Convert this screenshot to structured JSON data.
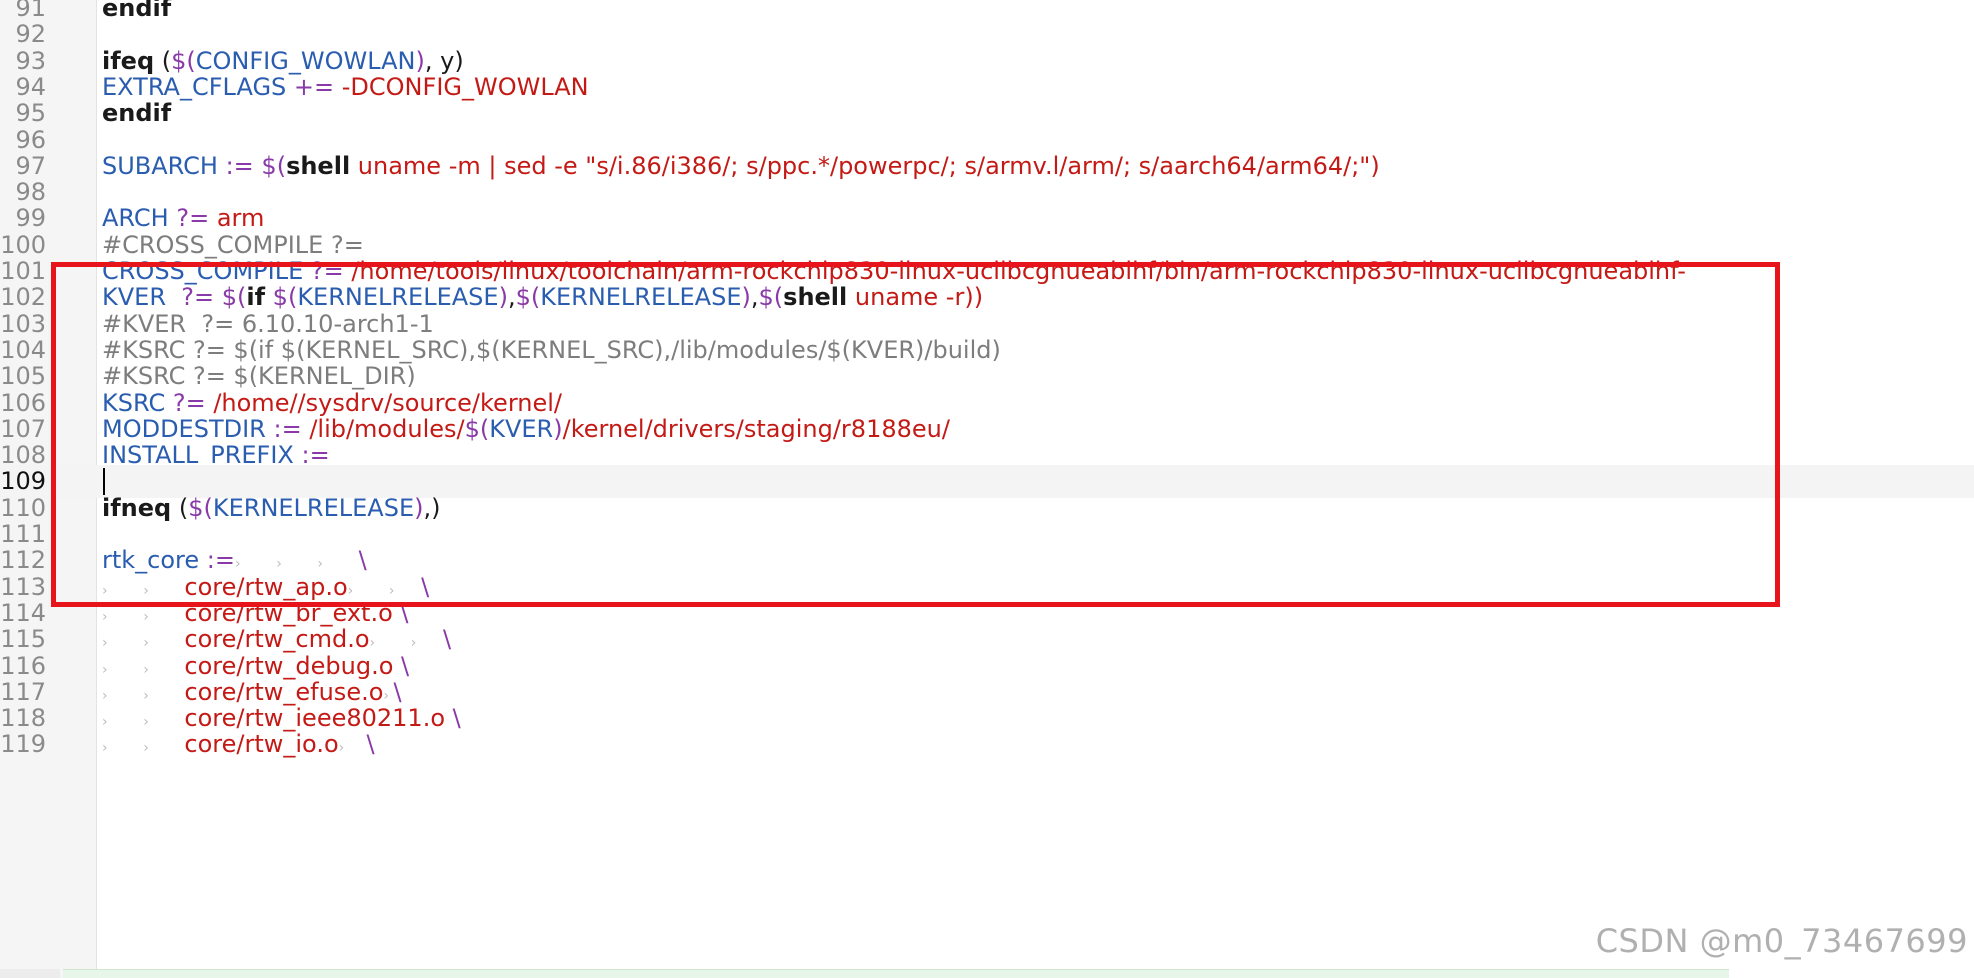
{
  "editor": {
    "current_line": "109",
    "lines": [
      {
        "n": "91",
        "tokens": [
          {
            "t": "kw",
            "x": "endif"
          }
        ]
      },
      {
        "n": "92",
        "tokens": []
      },
      {
        "n": "93",
        "tokens": [
          {
            "t": "kw",
            "x": "ifeq"
          },
          {
            "t": "p",
            "x": " ("
          },
          {
            "t": "op",
            "x": "$("
          },
          {
            "t": "v",
            "x": "CONFIG_WOWLAN"
          },
          {
            "t": "op",
            "x": ")"
          },
          {
            "t": "p",
            "x": ", y)"
          }
        ]
      },
      {
        "n": "94",
        "tokens": [
          {
            "t": "v",
            "x": "EXTRA_CFLAGS"
          },
          {
            "t": "op",
            "x": " += "
          },
          {
            "t": "s",
            "x": "-DCONFIG_WOWLAN"
          }
        ]
      },
      {
        "n": "95",
        "tokens": [
          {
            "t": "kw",
            "x": "endif"
          }
        ]
      },
      {
        "n": "96",
        "tokens": []
      },
      {
        "n": "97",
        "tokens": [
          {
            "t": "v",
            "x": "SUBARCH"
          },
          {
            "t": "op",
            "x": " := "
          },
          {
            "t": "op",
            "x": "$("
          },
          {
            "t": "kw",
            "x": "shell"
          },
          {
            "t": "s",
            "x": " uname -m | sed -e \"s/i.86/i386/; s/ppc.*/powerpc/; s/armv.l/arm/; s/aarch64/arm64/;\")"
          }
        ]
      },
      {
        "n": "98",
        "tokens": []
      },
      {
        "n": "99",
        "tokens": [
          {
            "t": "v",
            "x": "ARCH"
          },
          {
            "t": "op",
            "x": " ?= "
          },
          {
            "t": "s",
            "x": "arm"
          }
        ]
      },
      {
        "n": "100",
        "tokens": [
          {
            "t": "c",
            "x": "#CROSS_COMPILE ?="
          }
        ]
      },
      {
        "n": "101",
        "tokens": [
          {
            "t": "v",
            "x": "CROSS_COMPILE"
          },
          {
            "t": "op",
            "x": " ?= "
          },
          {
            "t": "s",
            "x": "/home/tools/linux/toolchain/arm-rockchip830-linux-uclibcgnueabihf/bin/arm-rockchip830-linux-uclibcgnueabihf-"
          }
        ]
      },
      {
        "n": "102",
        "tokens": [
          {
            "t": "v",
            "x": "KVER"
          },
          {
            "t": "op",
            "x": "  ?= "
          },
          {
            "t": "op",
            "x": "$("
          },
          {
            "t": "kw",
            "x": "if"
          },
          {
            "t": "op",
            "x": " $("
          },
          {
            "t": "v",
            "x": "KERNELRELEASE"
          },
          {
            "t": "op",
            "x": ")"
          },
          {
            "t": "p",
            "x": ","
          },
          {
            "t": "op",
            "x": "$("
          },
          {
            "t": "v",
            "x": "KERNELRELEASE"
          },
          {
            "t": "op",
            "x": ")"
          },
          {
            "t": "p",
            "x": ","
          },
          {
            "t": "op",
            "x": "$("
          },
          {
            "t": "kw",
            "x": "shell"
          },
          {
            "t": "s",
            "x": " uname -r))"
          }
        ]
      },
      {
        "n": "103",
        "tokens": [
          {
            "t": "c",
            "x": "#KVER  ?= 6.10.10-arch1-1"
          }
        ]
      },
      {
        "n": "104",
        "tokens": [
          {
            "t": "c",
            "x": "#KSRC ?= $(if $(KERNEL_SRC),$(KERNEL_SRC),/lib/modules/$(KVER)/build)"
          }
        ]
      },
      {
        "n": "105",
        "tokens": [
          {
            "t": "c",
            "x": "#KSRC ?= $(KERNEL_DIR)"
          }
        ]
      },
      {
        "n": "106",
        "tokens": [
          {
            "t": "v",
            "x": "KSRC"
          },
          {
            "t": "op",
            "x": " ?= "
          },
          {
            "t": "s",
            "x": "/home//sysdrv/source/kernel/"
          }
        ]
      },
      {
        "n": "107",
        "tokens": [
          {
            "t": "v",
            "x": "MODDESTDIR"
          },
          {
            "t": "op",
            "x": " := "
          },
          {
            "t": "s",
            "x": "/lib/modules/"
          },
          {
            "t": "op",
            "x": "$("
          },
          {
            "t": "v",
            "x": "KVER"
          },
          {
            "t": "op",
            "x": ")"
          },
          {
            "t": "s",
            "x": "/kernel/drivers/staging/r8188eu/"
          }
        ]
      },
      {
        "n": "108",
        "tokens": [
          {
            "t": "v",
            "x": "INSTALL_PREFIX"
          },
          {
            "t": "op",
            "x": " :="
          }
        ]
      },
      {
        "n": "109",
        "tokens": []
      },
      {
        "n": "110",
        "tokens": [
          {
            "t": "kw",
            "x": "ifneq"
          },
          {
            "t": "p",
            "x": " ("
          },
          {
            "t": "op",
            "x": "$("
          },
          {
            "t": "v",
            "x": "KERNELRELEASE"
          },
          {
            "t": "op",
            "x": ")"
          },
          {
            "t": "p",
            "x": ",)"
          }
        ]
      },
      {
        "n": "111",
        "tokens": []
      },
      {
        "n": "112",
        "tokens": [
          {
            "t": "v",
            "x": "rtk_core"
          },
          {
            "t": "op",
            "x": " :="
          },
          {
            "t": "tab",
            "x": "›        ›        ›        "
          },
          {
            "t": "op",
            "x": "\\"
          }
        ]
      },
      {
        "n": "113",
        "tokens": [
          {
            "t": "tab",
            "x": "›        ›        "
          },
          {
            "t": "s",
            "x": "core/rtw_ap.o"
          },
          {
            "t": "tab",
            "x": "›        ›      "
          },
          {
            "t": "op",
            "x": "\\"
          }
        ]
      },
      {
        "n": "114",
        "tokens": [
          {
            "t": "tab",
            "x": "›        ›        "
          },
          {
            "t": "s",
            "x": "core/rtw_br_ext.o"
          },
          {
            "t": "op",
            "x": " \\"
          }
        ]
      },
      {
        "n": "115",
        "tokens": [
          {
            "t": "tab",
            "x": "›        ›        "
          },
          {
            "t": "s",
            "x": "core/rtw_cmd.o"
          },
          {
            "t": "tab",
            "x": "›        ›      "
          },
          {
            "t": "op",
            "x": "\\"
          }
        ]
      },
      {
        "n": "116",
        "tokens": [
          {
            "t": "tab",
            "x": "›        ›        "
          },
          {
            "t": "s",
            "x": "core/rtw_debug.o"
          },
          {
            "t": "op",
            "x": " \\"
          }
        ]
      },
      {
        "n": "117",
        "tokens": [
          {
            "t": "tab",
            "x": "›        ›        "
          },
          {
            "t": "s",
            "x": "core/rtw_efuse.o"
          },
          {
            "t": "tab",
            "x": "› "
          },
          {
            "t": "op",
            "x": "\\"
          }
        ]
      },
      {
        "n": "118",
        "tokens": [
          {
            "t": "tab",
            "x": "›        ›        "
          },
          {
            "t": "s",
            "x": "core/rtw_ieee80211.o"
          },
          {
            "t": "op",
            "x": " \\"
          }
        ]
      },
      {
        "n": "119",
        "tokens": [
          {
            "t": "tab",
            "x": "›        ›        "
          },
          {
            "t": "s",
            "x": "core/rtw_io.o"
          },
          {
            "t": "tab",
            "x": "›     "
          },
          {
            "t": "op",
            "x": "\\"
          }
        ]
      }
    ]
  },
  "watermark": "CSDN @m0_73467699",
  "colors": {
    "highlight_box": "#e8141b",
    "variable": "#2a5db0",
    "operator": "#8a3aa8",
    "string": "#c41a16",
    "comment": "#7d7d7d"
  }
}
